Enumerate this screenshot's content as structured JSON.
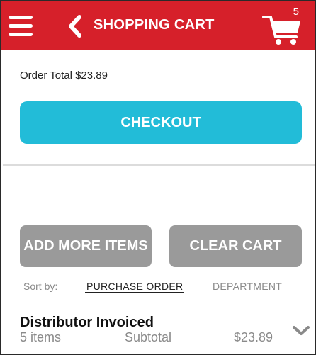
{
  "header": {
    "title": "SHOPPING CART",
    "cart_count": "5",
    "menu_icon": "hamburger-menu-icon",
    "back_icon": "chevron-left-icon",
    "cart_icon": "shopping-cart-icon",
    "bg_color": "#d6202a"
  },
  "order": {
    "total_text": "Order Total $23.89"
  },
  "buttons": {
    "checkout_label": "CHECKOUT",
    "checkout_color": "#22bcd8",
    "add_more_label": "ADD MORE ITEMS",
    "clear_cart_label": "CLEAR CART",
    "secondary_color": "#9a9a9a"
  },
  "sort": {
    "label": "Sort by:",
    "options": [
      "PURCHASE ORDER",
      "DEPARTMENT"
    ],
    "selected": "PURCHASE ORDER"
  },
  "groups": [
    {
      "title": "Distributor Invoiced",
      "item_count": "5 items",
      "subtotal_label": "Subtotal",
      "subtotal_value": "$23.89",
      "expand_icon": "chevron-down-icon"
    }
  ]
}
